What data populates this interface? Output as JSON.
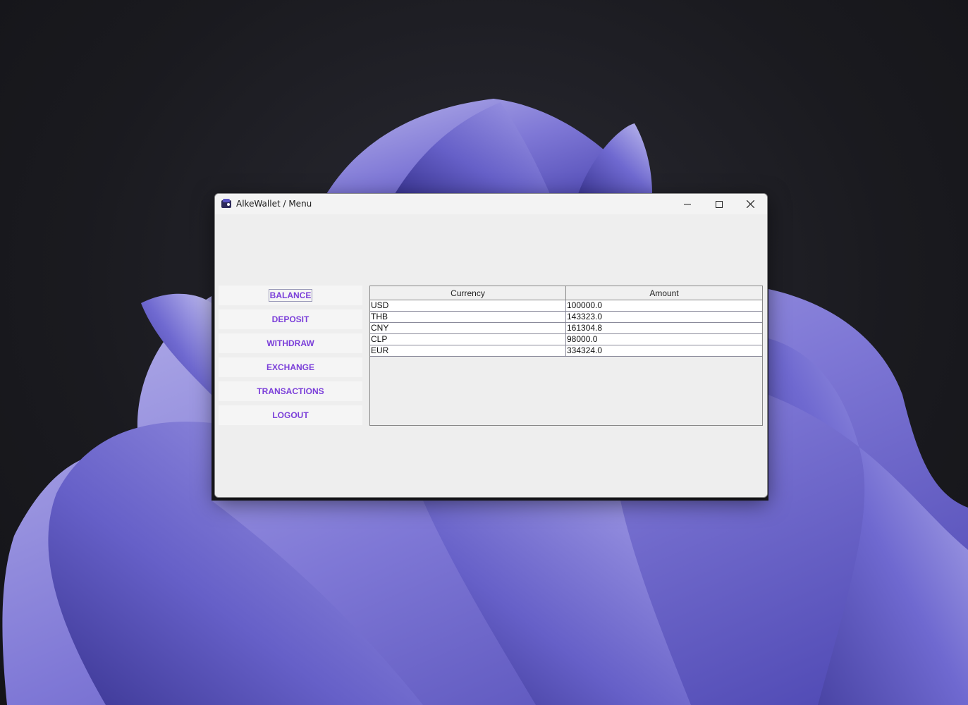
{
  "window": {
    "title": "AlkeWallet / Menu"
  },
  "menu": {
    "items": [
      {
        "label": "BALANCE",
        "focused": true
      },
      {
        "label": "DEPOSIT"
      },
      {
        "label": "WITHDRAW"
      },
      {
        "label": "EXCHANGE"
      },
      {
        "label": "TRANSACTIONS"
      },
      {
        "label": "LOGOUT"
      }
    ]
  },
  "balance_table": {
    "columns": [
      "Currency",
      "Amount"
    ],
    "rows": [
      [
        "USD",
        "100000.0"
      ],
      [
        "THB",
        "143323.0"
      ],
      [
        "CNY",
        "161304.8"
      ],
      [
        "CLP",
        "98000.0"
      ],
      [
        "EUR",
        "334324.0"
      ]
    ]
  },
  "colors": {
    "accent": "#7b3fd9",
    "window_bg": "#eeeeee"
  },
  "icons": {
    "app": "wallet-app-icon",
    "minimize": "minimize-icon",
    "maximize": "maximize-icon",
    "close": "close-icon"
  }
}
